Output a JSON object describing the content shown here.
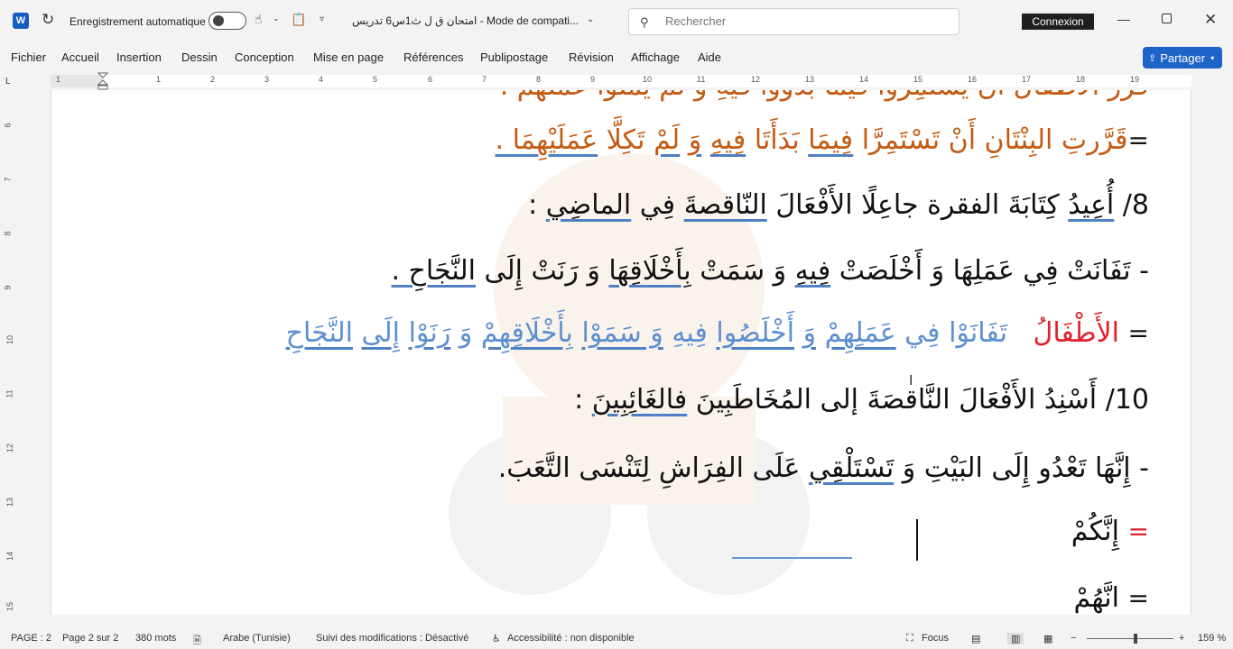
{
  "titlebar": {
    "app_icon": "W",
    "autosave_label": "Enregistrement automatique",
    "doc_title": "امتحان ق ل ث1س6 تدريس  -  Mode de compati...",
    "search_placeholder": "Rechercher",
    "connexion_label": "Connexion"
  },
  "menu": {
    "items": [
      "Fichier",
      "Accueil",
      "Insertion",
      "Dessin",
      "Conception",
      "Mise en page",
      "Références",
      "Publipostage",
      "Révision",
      "Affichage",
      "Aide"
    ],
    "share_label": "Partager"
  },
  "ruler": {
    "ticks": [
      "1",
      "1",
      "2",
      "3",
      "4",
      "5",
      "6",
      "7",
      "8",
      "9",
      "10",
      "11",
      "12",
      "13",
      "14",
      "15",
      "16",
      "17",
      "18",
      "19"
    ],
    "vticks": [
      "6",
      "7",
      "8",
      "9",
      "10",
      "11",
      "12",
      "13",
      "14",
      "15"
    ]
  },
  "document": {
    "line_top_cut": "قرَّرَ الأطفالُ أنْ يَستمِرّوا فيما بدؤوا فيهِ وَ لمْ يمَلّوا عَمَلَهم .",
    "line1_eq": "=",
    "line1_a": "قَرَّرتِ البِنْتَانِ أَنْ",
    "line1_b": "تَسْتَمِرَّا",
    "line1_c": "فِيمَا",
    "line1_d": "بَدَأَتَا",
    "line1_e": "فِيهِ",
    "line1_f": "وَ",
    "line1_g": "لَمْ",
    "line1_h": "تَكِلَّا",
    "line1_i": "عَمَلَيْهِمَا .",
    "q8_num": "8/",
    "q8_a": "أُعِيدُ",
    "q8_b": "كِتَابَةَ الفقرة  جاعِلًا الأَفْعَالَ",
    "q8_c": "النّاقصةَ",
    "q8_d": "فِي",
    "q8_e": "الماضِي",
    "q8_f": ":",
    "s1_a": "- تَفَانَتْ فِي عَمَلِهَا وَ أَخْلَصَتْ",
    "s1_b": "فِيهِ",
    "s1_c": "وَ سَمَتْ",
    "s1_d": "بِأَخْلَاقِهَا",
    "s1_e": "وَ رَنَتْ إِلَى",
    "s1_f": "النَّجَاحِ .",
    "a1_eq": "=",
    "a1_red": "الأَطْفَالُ",
    "a1_a": "تَفَانَوْا",
    "a1_b": "فِي",
    "a1_c": "عَمَلِهِمْ",
    "a1_d": "وَ",
    "a1_e": "أَخْلَصُوا",
    "a1_f": "فِيهِ",
    "a1_g": "وَ سَمَوْا",
    "a1_h": "بِأَخْلَاقِهِمْ",
    "a1_i": "وَ",
    "a1_j": "رَنَوْا",
    "a1_k": "إِلَى",
    "a1_l": "النَّجَاحِ",
    "q10_num": "10/",
    "q10_a": "أَسْنِدُ الأَفْعَالَ النَّاقصَةَ إلى المُخَاطَبِينَ",
    "q10_b": "فالغَائِبِينَ",
    "q10_c": ":",
    "s2_a": "- إِنَّهَا تَعْدُو إِلَى البَيْتِ وَ",
    "s2_b": "تَسْتَلْقِي",
    "s2_c": "عَلَى الفِرَاشِ لِتَنْسَى التَّعَبَ.",
    "a2_eq": "=",
    "a2_word": "إِنَّكُمْ",
    "a3_eq": "=",
    "a3_word": "انَّهُمْ"
  },
  "status": {
    "page": "PAGE : 2",
    "page_of": "Page 2 sur 2",
    "words": "380 mots",
    "language": "Arabe (Tunisie)",
    "track_changes": "Suivi des modifications : Désactivé",
    "accessibility": "Accessibilité : non disponible",
    "focus": "Focus",
    "zoom_minus": "−",
    "zoom_plus": "+",
    "zoom": "159 %"
  },
  "colors": {
    "share": "#1e63c8",
    "orange_text": "#c55a11",
    "blue_text": "#5b8fd1",
    "red_text": "#e0202a"
  }
}
